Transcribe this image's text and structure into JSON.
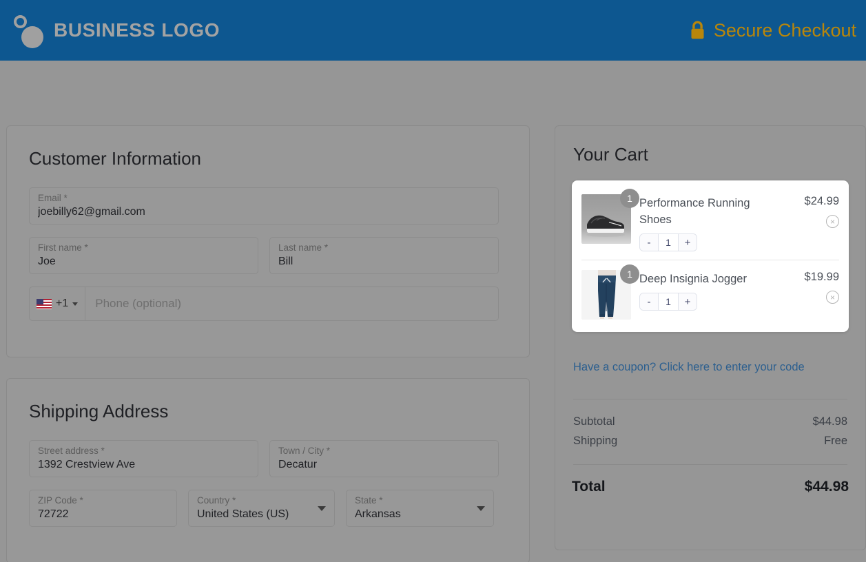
{
  "header": {
    "brand_name": "BUSINESS LOGO",
    "secure_label": "Secure Checkout",
    "lock_icon": "lock-icon",
    "logo_icon": "business-logo-icon",
    "bg_color": "#0d5790",
    "secure_color": "#b8860b"
  },
  "customer": {
    "title": "Customer Information",
    "email": {
      "label": "Email *",
      "value": "joebilly62@gmail.com"
    },
    "first_name": {
      "label": "First name *",
      "value": "Joe"
    },
    "last_name": {
      "label": "Last name *",
      "value": "Bill"
    },
    "phone": {
      "dial_code": "+1",
      "flag_icon": "us-flag-icon",
      "placeholder": "Phone (optional)",
      "value": ""
    }
  },
  "shipping": {
    "title": "Shipping Address",
    "street": {
      "label": "Street address *",
      "value": "1392 Crestview Ave"
    },
    "city": {
      "label": "Town / City *",
      "value": "Decatur"
    },
    "zip": {
      "label": "ZIP Code *",
      "value": "72722"
    },
    "country": {
      "label": "Country *",
      "value": "United States (US)"
    },
    "state": {
      "label": "State *",
      "value": "Arkansas"
    }
  },
  "cart": {
    "title": "Your Cart",
    "items": [
      {
        "name": "Performance Running Shoes",
        "price": "$24.99",
        "quantity": "1",
        "decrement_label": "-",
        "increment_label": "+",
        "remove_label": "×",
        "thumbnail": "running-shoes-thumbnail"
      },
      {
        "name": "Deep Insignia Jogger",
        "price": "$19.99",
        "quantity": "1",
        "decrement_label": "-",
        "increment_label": "+",
        "remove_label": "×",
        "thumbnail": "jogger-pants-thumbnail"
      }
    ],
    "coupon_link": "Have a coupon? Click here to enter your code",
    "subtotal_label": "Subtotal",
    "subtotal_value": "$44.98",
    "shipping_label": "Shipping",
    "shipping_value": "Free",
    "total_label": "Total",
    "total_value": "$44.98"
  }
}
